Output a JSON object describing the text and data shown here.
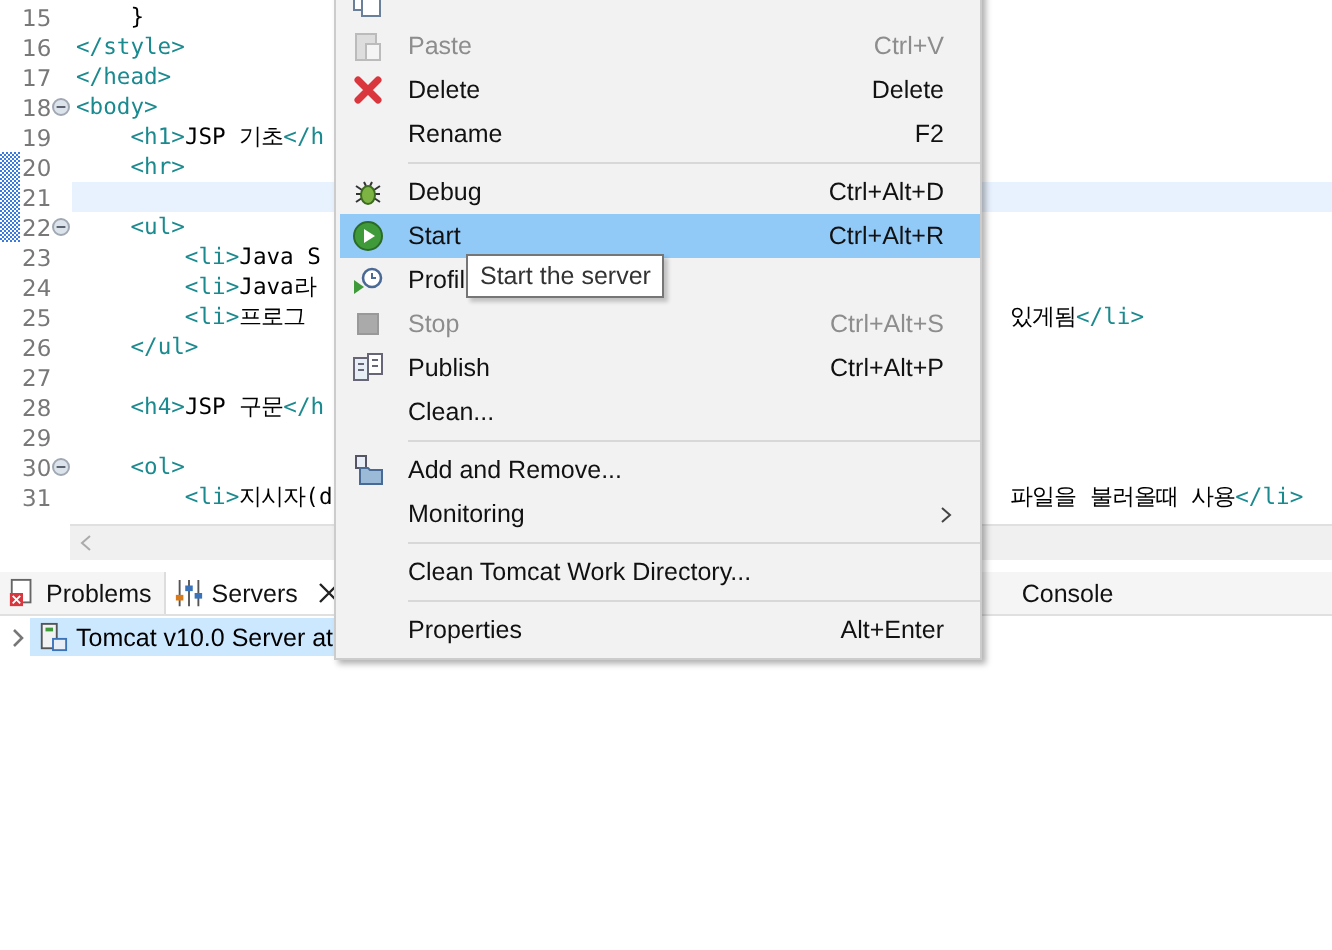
{
  "editor": {
    "lines": [
      {
        "number": "15",
        "text": "    }"
      },
      {
        "number": "16",
        "text": "</style>"
      },
      {
        "number": "17",
        "text": "</head>"
      },
      {
        "number": "18",
        "text": "<body>",
        "foldable": true
      },
      {
        "number": "19",
        "text": "    <h1>JSP 기초</h"
      },
      {
        "number": "20",
        "text": "    <hr>"
      },
      {
        "number": "21",
        "current": true
      },
      {
        "number": "22",
        "text": "    <ul>",
        "foldable": true
      },
      {
        "number": "23",
        "text": "        <li>Java S"
      },
      {
        "number": "24",
        "text": "        <li>Java라"
      },
      {
        "number": "25",
        "text": "        <li>프로그",
        "tail": "있게됨</li>"
      },
      {
        "number": "26",
        "text": "    </ul>"
      },
      {
        "number": "27"
      },
      {
        "number": "28",
        "text": "    <h4>JSP 구문</h"
      },
      {
        "number": "29"
      },
      {
        "number": "30",
        "text": "    <ol>",
        "foldable": true
      },
      {
        "number": "31",
        "text": "        <li>지시자(d",
        "tail": "파일을 불러올때 사용</li>"
      }
    ]
  },
  "panel": {
    "tabs": [
      {
        "label": "Problems",
        "selected": false,
        "closable": false
      },
      {
        "label": "Servers",
        "selected": true,
        "closable": true
      },
      {
        "label": "Console",
        "selected": false,
        "closable": false
      }
    ],
    "tree": [
      {
        "label": "Tomcat v10.0 Server at",
        "selected": true,
        "expanded": false
      }
    ]
  },
  "context_menu": {
    "items": [
      {
        "kind": "item"
      },
      {
        "kind": "item",
        "label": "Paste",
        "shortcut": "Ctrl+V",
        "disabled": true,
        "selected": false
      },
      {
        "kind": "item",
        "label": "Delete",
        "shortcut": "Delete",
        "disabled": false,
        "selected": false
      },
      {
        "kind": "item",
        "label": "Rename",
        "shortcut": "F2",
        "disabled": false,
        "selected": false
      },
      {
        "kind": "separator"
      },
      {
        "kind": "item",
        "label": "Debug",
        "shortcut": "Ctrl+Alt+D",
        "disabled": false,
        "selected": false
      },
      {
        "kind": "item",
        "label": "Start",
        "shortcut": "Ctrl+Alt+R",
        "disabled": false,
        "selected": true
      },
      {
        "kind": "item",
        "label": "Profil",
        "disabled": false,
        "selected": false
      },
      {
        "kind": "item",
        "label": "Stop",
        "shortcut": "Ctrl+Alt+S",
        "disabled": true,
        "selected": false
      },
      {
        "kind": "item",
        "label": "Publish",
        "shortcut": "Ctrl+Alt+P",
        "disabled": false,
        "selected": false
      },
      {
        "kind": "item",
        "label": "Clean...",
        "disabled": false,
        "selected": false
      },
      {
        "kind": "separator"
      },
      {
        "kind": "item",
        "label": "Add and Remove...",
        "disabled": false,
        "selected": false
      },
      {
        "kind": "item",
        "label": "Monitoring",
        "submenu": true,
        "disabled": false,
        "selected": false
      },
      {
        "kind": "separator"
      },
      {
        "kind": "item",
        "label": "Clean Tomcat Work Directory...",
        "disabled": false,
        "selected": false
      },
      {
        "kind": "separator"
      },
      {
        "kind": "item",
        "label": "Properties",
        "shortcut": "Alt+Enter",
        "disabled": false,
        "selected": false
      }
    ]
  },
  "tooltip": {
    "text": "Start the server"
  }
}
